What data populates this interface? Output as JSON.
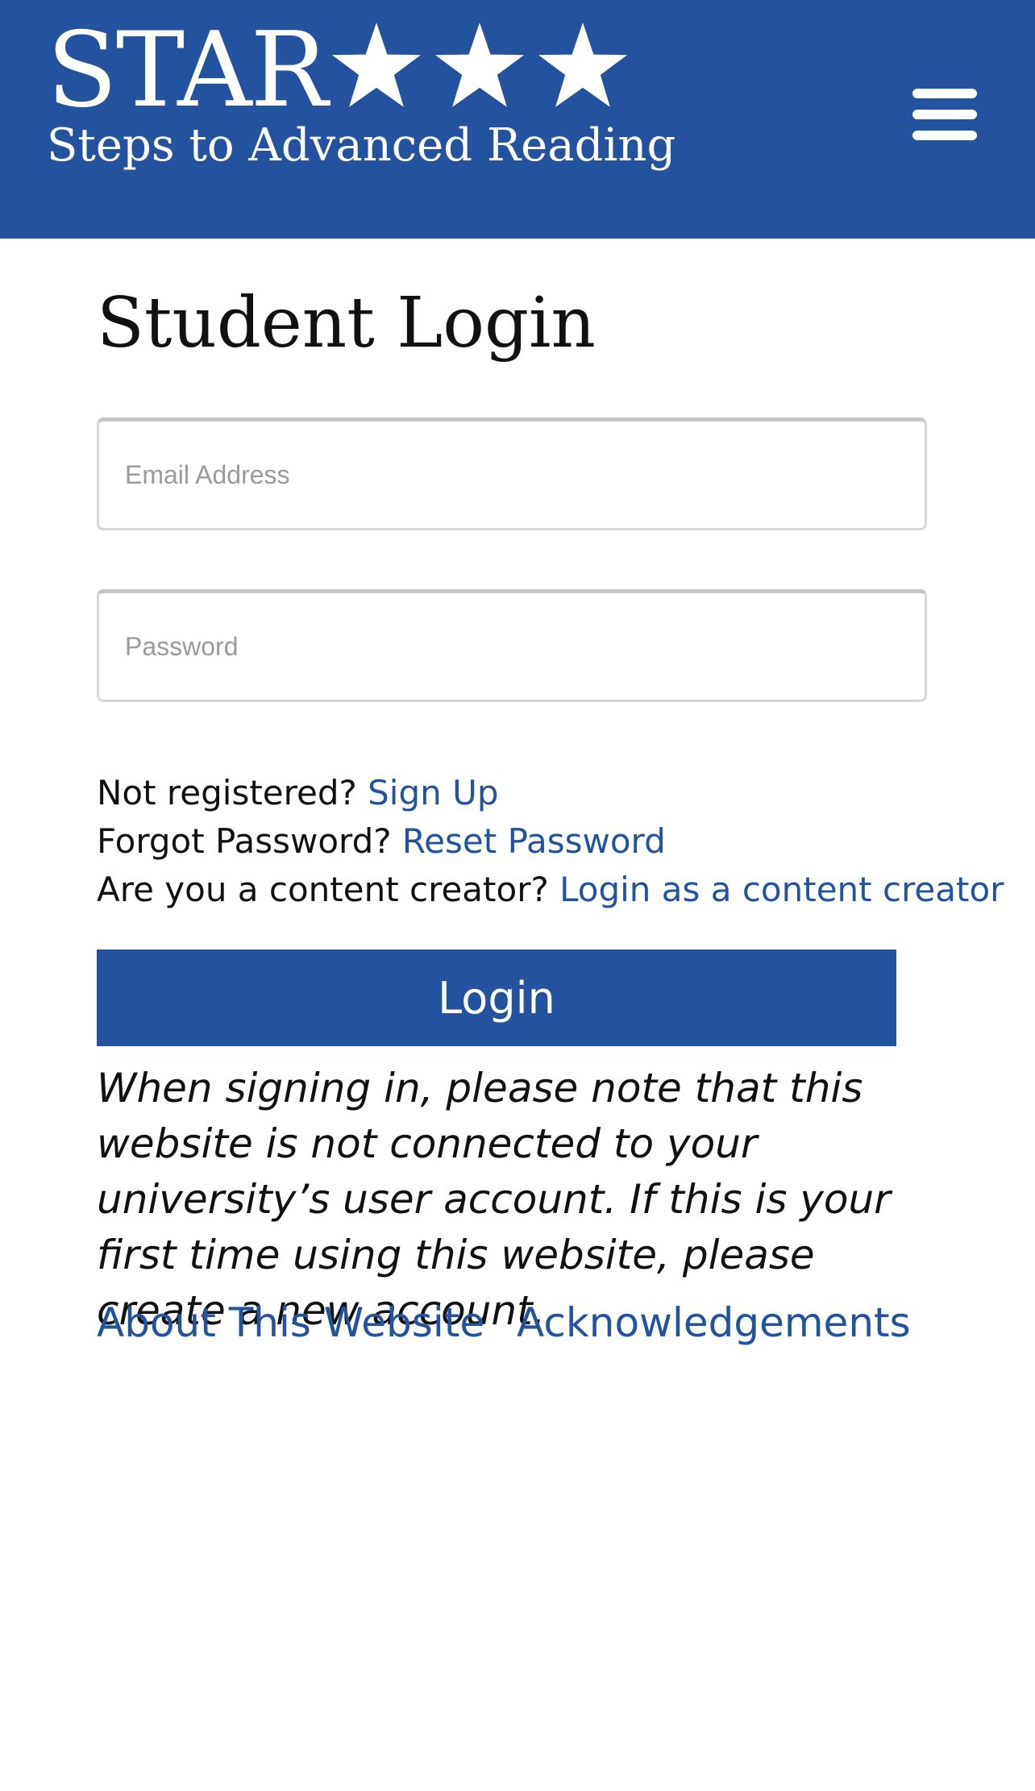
{
  "header": {
    "logo": {
      "wordmark": "STAR",
      "stars_icon": "three-stars-icon",
      "tagline": "Steps to Advanced Reading"
    },
    "menu_icon": "hamburger-menu-icon",
    "background_color": "#23529f"
  },
  "main": {
    "title": "Student Login",
    "email": {
      "placeholder": "Email Address",
      "value": ""
    },
    "password": {
      "placeholder": "Password",
      "value": ""
    },
    "links": {
      "signup_prompt": "Not registered?",
      "signup_link": "Sign Up",
      "forgot_prompt": "Forgot Password?",
      "forgot_link": "Reset Password",
      "creator_prompt": "Are you a content creator?",
      "creator_link": "Login as a content creator"
    },
    "login_button": "Login",
    "notice": "When signing in, please note that this website is not connected to your university’s user account. If this is your first time using this website, please create a new account."
  },
  "footer": {
    "about_link": "About This Website",
    "acknowledgements_link": "Acknowledgements"
  },
  "colors": {
    "brand_blue": "#23529f",
    "link_blue": "#23529f",
    "text": "#111111"
  }
}
